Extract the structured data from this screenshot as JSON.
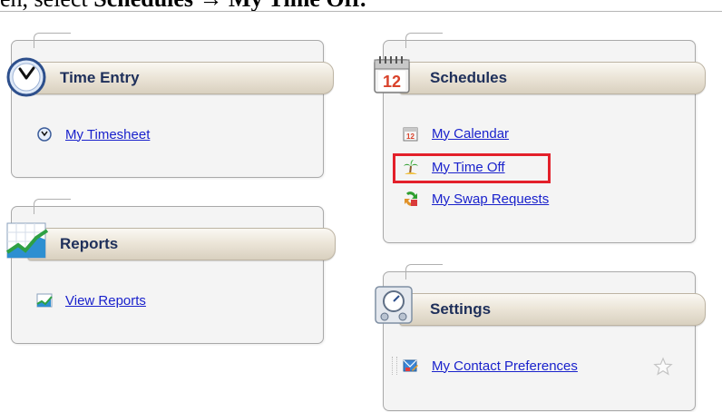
{
  "instruction": {
    "prefix": "en, select ",
    "bold1": "Schedules",
    "arrow": "→",
    "bold2": "My Time Off."
  },
  "panels": {
    "time_entry": {
      "title": "Time Entry",
      "links": [
        "My Timesheet"
      ]
    },
    "reports": {
      "title": "Reports",
      "links": [
        "View Reports"
      ]
    },
    "schedules": {
      "title": "Schedules",
      "calendar_icon_number": "12",
      "links": [
        "My Calendar",
        "My Time Off",
        "My Swap Requests"
      ],
      "highlighted_link": "My Time Off"
    },
    "settings": {
      "title": "Settings",
      "links": [
        "My Contact Preferences"
      ]
    }
  },
  "colors": {
    "link": "#1a22cc",
    "ribbon_title": "#1e2f5a",
    "highlight": "#e3202a"
  }
}
